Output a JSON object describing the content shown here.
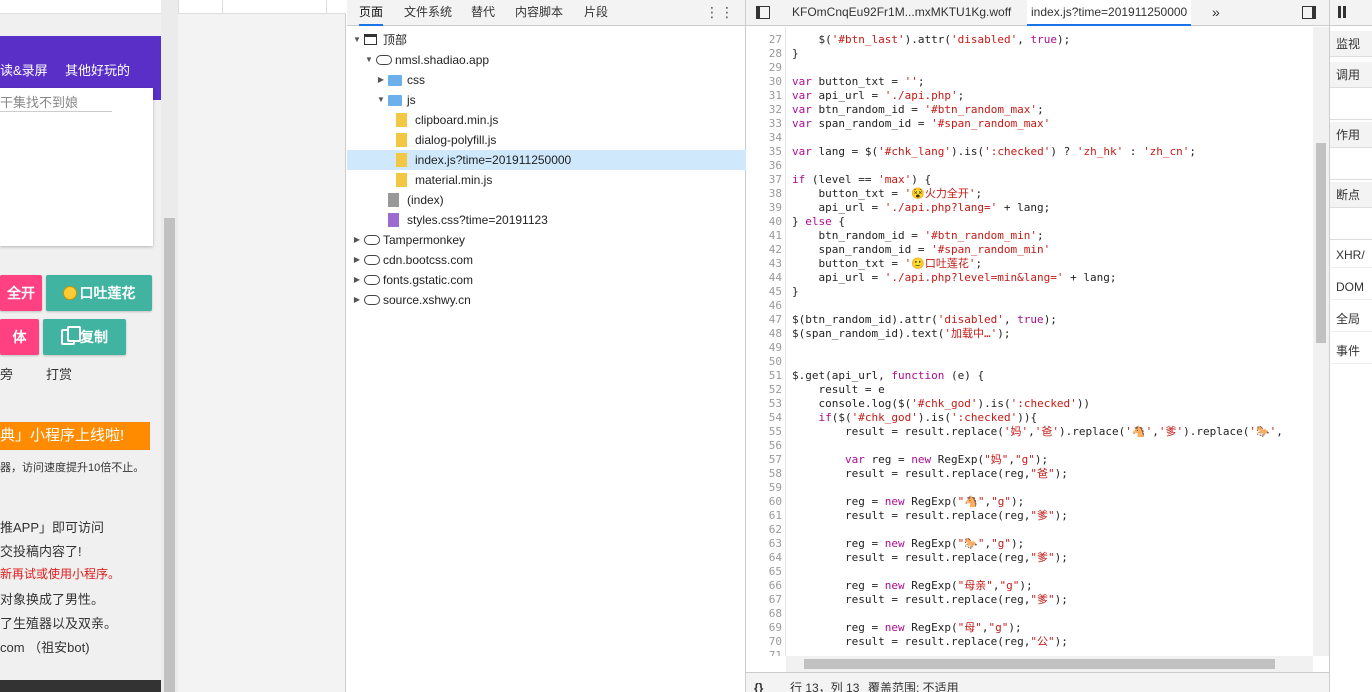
{
  "webpage": {
    "nav": [
      "读&录屏",
      "其他好玩的"
    ],
    "search_text": "干集找不到娘",
    "buttons": {
      "fire_label": "全开",
      "mouth_label": "口吐莲花",
      "body_label": "体",
      "copy_label": "复制"
    },
    "labels": [
      "旁",
      "打赏"
    ],
    "banner": "典」小程序上线啦!",
    "lines": [
      "器，访问速度提升10倍不止。",
      "推APP」即可访问",
      "交投稿内容了!",
      "新再试或使用小程序。",
      "对象换成了男性。",
      "了生殖器以及双亲。",
      "com （祖安bot)"
    ]
  },
  "navigator": {
    "tabs": [
      "页面",
      "文件系统",
      "替代",
      "内容脚本",
      "片段"
    ],
    "tree": [
      {
        "label": "顶部",
        "icon": "frame-icon",
        "depth": 0,
        "arrow": "▼"
      },
      {
        "label": "nmsl.shadiao.app",
        "icon": "cloud-icon",
        "depth": 1,
        "arrow": "▼"
      },
      {
        "label": "css",
        "icon": "folder-icon",
        "depth": 2,
        "arrow": "▶"
      },
      {
        "label": "js",
        "icon": "folder-icon",
        "depth": 2,
        "arrow": "▼"
      },
      {
        "label": "clipboard.min.js",
        "icon": "file-icon",
        "depth": 3,
        "arrow": ""
      },
      {
        "label": "dialog-polyfill.js",
        "icon": "file-icon",
        "depth": 3,
        "arrow": ""
      },
      {
        "label": "index.js?time=201911250000",
        "icon": "file-icon",
        "depth": 3,
        "arrow": "",
        "selected": true
      },
      {
        "label": "material.min.js",
        "icon": "file-icon",
        "depth": 3,
        "arrow": ""
      },
      {
        "label": "(index)",
        "icon": "file-grey-icon",
        "depth": 2,
        "arrow": ""
      },
      {
        "label": "styles.css?time=20191123",
        "icon": "file-purple-icon",
        "depth": 2,
        "arrow": ""
      },
      {
        "label": "Tampermonkey",
        "icon": "cloud-icon",
        "depth": 0,
        "arrow": "▶"
      },
      {
        "label": "cdn.bootcss.com",
        "icon": "cloud-icon",
        "depth": 0,
        "arrow": "▶"
      },
      {
        "label": "fonts.gstatic.com",
        "icon": "cloud-icon",
        "depth": 0,
        "arrow": "▶"
      },
      {
        "label": "source.xshwy.cn",
        "icon": "cloud-icon",
        "depth": 0,
        "arrow": "▶"
      }
    ]
  },
  "editor": {
    "tabs": [
      "KFOmCnqEu92Fr1M...mxMKTU1Kg.woff",
      "index.js?time=201911250000"
    ],
    "more_tabs": "»",
    "first_line_number": 27,
    "lines": [
      "    $('#btn_last').attr('disabled', true);",
      "}",
      "",
      "var button_txt = '';",
      "var api_url = './api.php';",
      "var btn_random_id = '#btn_random_max';",
      "var span_random_id = '#span_random_max'",
      "",
      "var lang = $('#chk_lang').is(':checked') ? 'zh_hk' : 'zh_cn';",
      "",
      "if (level == 'max') {",
      "    button_txt = '😵火力全开';",
      "    api_url = './api.php?lang=' + lang;",
      "} else {",
      "    btn_random_id = '#btn_random_min';",
      "    span_random_id = '#span_random_min'",
      "    button_txt = '🙂口吐莲花';",
      "    api_url = './api.php?level=min&lang=' + lang;",
      "}",
      "",
      "$(btn_random_id).attr('disabled', true);",
      "$(span_random_id).text('加载中…');",
      "",
      "",
      "$.get(api_url, function (e) {",
      "    result = e",
      "    console.log($('#chk_god').is(':checked'))",
      "    if($('#chk_god').is(':checked')){",
      "        result = result.replace('妈','爸').replace('🐴','爹').replace('🐎',",
      "",
      "        var reg = new RegExp(\"妈\",\"g\");",
      "        result = result.replace(reg,\"爸\");",
      "",
      "        reg = new RegExp(\"🐴\",\"g\");",
      "        result = result.replace(reg,\"爹\");",
      "",
      "        reg = new RegExp(\"🐎\",\"g\");",
      "        result = result.replace(reg,\"爹\");",
      "",
      "        reg = new RegExp(\"母亲\",\"g\");",
      "        result = result.replace(reg,\"爹\");",
      "",
      "        reg = new RegExp(\"母\",\"g\");",
      "        result = result.replace(reg,\"公\");",
      "",
      ""
    ],
    "status": {
      "braces": "{}",
      "position": "行 13，列 13",
      "coverage": "覆盖范围: 不适用"
    }
  },
  "sidebar": {
    "pause_icon": "pause-icon",
    "sections": [
      "监视",
      "调用",
      "作用",
      "断点",
      "XHR/",
      "DOM",
      "全局",
      "事件"
    ]
  },
  "colors": {
    "nav_purple": "#5a2fc7",
    "pink": "#ff4081",
    "teal": "#40b4a0",
    "banner_orange": "#ff8c00",
    "selection": "#cfe8fc",
    "arrow_red": "#e53935",
    "keyword": "#aa0d91",
    "string": "#c41a16",
    "number": "#1c00cf"
  }
}
